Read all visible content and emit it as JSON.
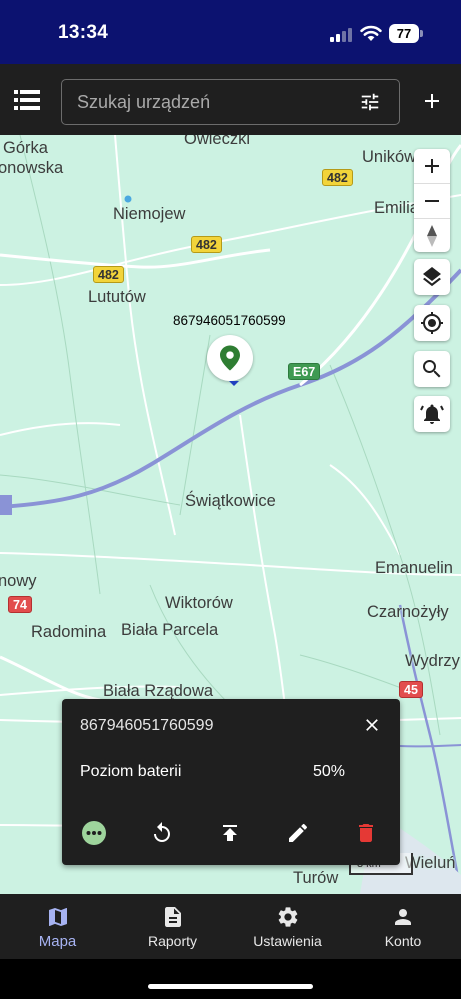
{
  "status_bar": {
    "time": "13:34",
    "battery": "77"
  },
  "search": {
    "placeholder": "Szukaj urządzeń"
  },
  "map": {
    "places": [
      "Górka",
      "onowska",
      "Owieczki",
      "Uników",
      "Niemojew",
      "Emilia",
      "Lututów",
      "Świątkowice",
      "Emanuelin",
      "nowy",
      "Czarnożyły",
      "Wiktorów",
      "Radomina",
      "Biała Parcela",
      "Wydrzy",
      "Biała Rządowa",
      "Wieluń",
      "Turów"
    ],
    "road_numbers": [
      "482",
      "482",
      "482",
      "E67",
      "74",
      "45"
    ],
    "scale": "3 km"
  },
  "marker": {
    "label": "867946051760599",
    "color": "#2e7d32"
  },
  "popup": {
    "title": "867946051760599",
    "attribute_label": "Poziom baterii",
    "attribute_value": "50%"
  },
  "bottom_nav": {
    "items": [
      {
        "label": "Mapa",
        "icon": "map-icon",
        "active": true
      },
      {
        "label": "Raporty",
        "icon": "description-icon",
        "active": false
      },
      {
        "label": "Ustawienia",
        "icon": "settings-icon",
        "active": false
      },
      {
        "label": "Konto",
        "icon": "person-icon",
        "active": false
      }
    ]
  },
  "colors": {
    "status_bar": "#0c1270",
    "app_bar": "#1f1f1f",
    "map_background": "#ccf2e2",
    "accent": "#a7b3f2",
    "delete": "#e53935",
    "more_button": "#9ed49c"
  }
}
